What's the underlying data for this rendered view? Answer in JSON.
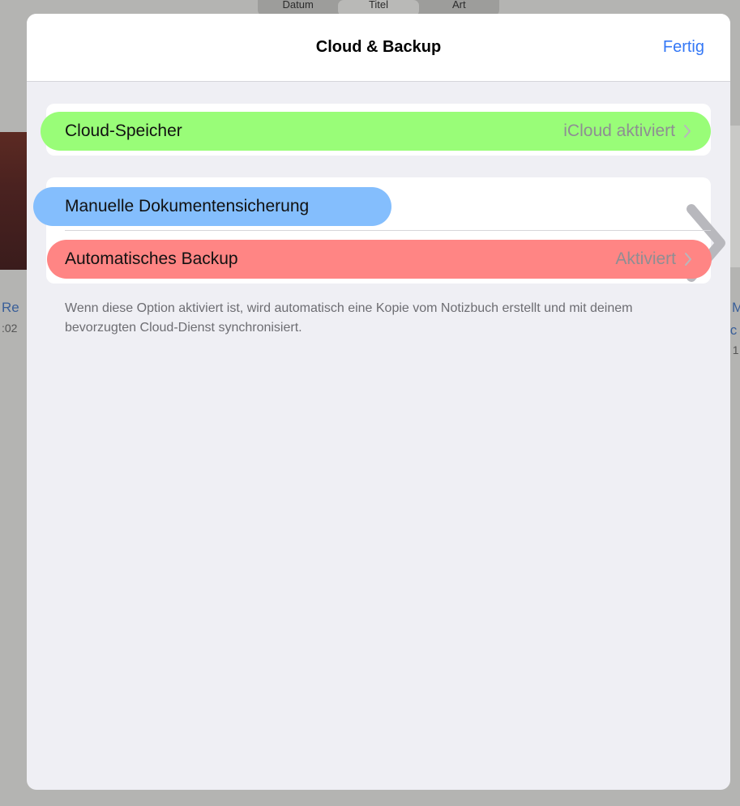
{
  "background_app": {
    "segments": [
      "Datum",
      "Titel",
      "Art"
    ],
    "left_title": "Re",
    "left_sub": ":02",
    "right_title": "M",
    "right_title2": ".c",
    "right_sub": ", 1"
  },
  "sheet": {
    "title": "Cloud & Backup",
    "done_label": "Fertig"
  },
  "rows": {
    "cloud": {
      "label": "Cloud-Speicher",
      "detail": "iCloud aktiviert",
      "highlight": "#99fd78"
    },
    "manual": {
      "label": "Manuelle Dokumentensicherung",
      "detail": "",
      "highlight": "#84befd"
    },
    "auto": {
      "label": "Automatisches Backup",
      "detail": "Aktiviert",
      "highlight": "#ff8584"
    }
  },
  "footer": "Wenn diese Option aktiviert ist, wird automatisch eine Kopie vom Notizbuch erstellt und mit deinem bevorzugten Cloud-Dienst synchronisiert."
}
